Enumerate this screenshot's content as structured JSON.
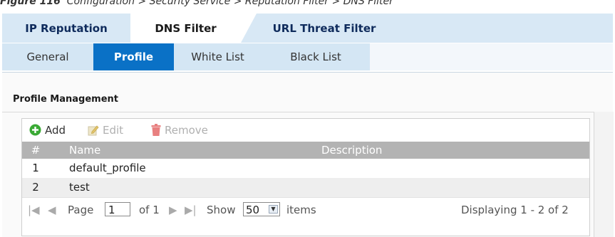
{
  "caption": {
    "prefix": "Figure 116",
    "text": "Configuration > Security Service > Reputation Filter > DNS Filter"
  },
  "main_tabs": [
    {
      "label": "IP Reputation"
    },
    {
      "label": "DNS Filter"
    },
    {
      "label": "URL Threat Filter"
    }
  ],
  "sub_tabs": [
    {
      "label": "General"
    },
    {
      "label": "Profile"
    },
    {
      "label": "White List"
    },
    {
      "label": "Black List"
    }
  ],
  "section": {
    "title": "Profile Management"
  },
  "toolbar": {
    "add_label": "Add",
    "edit_label": "Edit",
    "remove_label": "Remove"
  },
  "table": {
    "headers": {
      "num": "#",
      "name": "Name",
      "description": "Description"
    },
    "rows": [
      {
        "num": "1",
        "name": "default_profile",
        "description": ""
      },
      {
        "num": "2",
        "name": "test",
        "description": ""
      }
    ]
  },
  "pager": {
    "page_label": "Page",
    "page_value": "1",
    "of_label": "of 1",
    "show_label": "Show",
    "show_value": "50",
    "items_label": "items",
    "display_text": "Displaying 1 - 2 of 2"
  },
  "colors": {
    "active_subtab": "#0a71c6",
    "tab_bar": "#d8e8f5",
    "grid_header": "#b3b3b3",
    "add_icon": "#3aaa35",
    "remove_icon": "#e88080"
  }
}
